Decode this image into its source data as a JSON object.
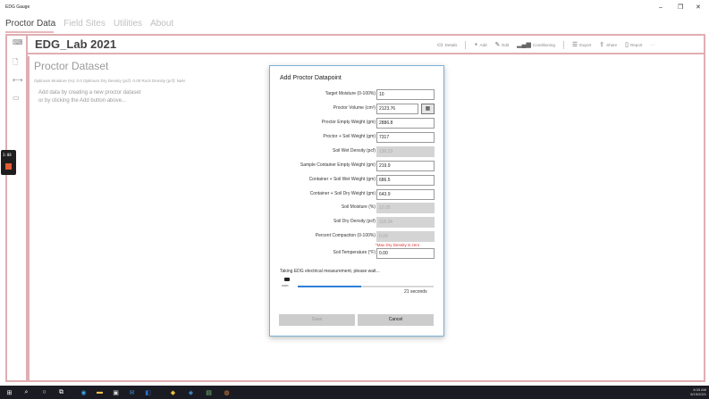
{
  "app": {
    "title": "EDG Gauge",
    "window_controls": {
      "minimize": "–",
      "maximize": "❐",
      "close": "✕"
    }
  },
  "nav": {
    "tabs": [
      {
        "label": "Proctor Data",
        "active": true
      },
      {
        "label": "Field Sites",
        "active": false
      },
      {
        "label": "Utilities",
        "active": false
      },
      {
        "label": "About",
        "active": false
      }
    ]
  },
  "header": {
    "title": "EDG_Lab  2021"
  },
  "toolbar": {
    "details": "Details",
    "add": "Add",
    "edit": "Edit",
    "conditioning": "Conditioning",
    "export": "Export",
    "share": "Share",
    "report": "Report",
    "more": "···"
  },
  "dataset": {
    "title": "Proctor Dataset",
    "meta": "Optimum Moisture (%): 0.0  Optimum Dry Density (pcf): 0.00  Rock Density (pcf): NaN",
    "hint_line1": "Add data by creating a new proctor dataset",
    "hint_line2": "or by clicking the Add button above..."
  },
  "recorder": {
    "time": "3:08"
  },
  "dialog": {
    "title": "Add Proctor Datapoint",
    "fields": [
      {
        "label": "Target Moisture (0-100%)",
        "value": "10",
        "readonly": false
      },
      {
        "label": "Proctor Volume (cm³)",
        "value": "2123.76",
        "readonly": false
      },
      {
        "label": "Proctor Empty Weight (gm)",
        "value": "2886.8",
        "readonly": false
      },
      {
        "label": "Proctor + Soil Weight (gm)",
        "value": "7317",
        "readonly": false
      },
      {
        "label": "Soil Wet Density (pcf)",
        "value": "130.23",
        "readonly": true
      },
      {
        "label": "Sample Container Empty Weight (gm)",
        "value": "219.9",
        "readonly": false
      },
      {
        "label": "Container + Soil Wet Weight (gm)",
        "value": "686.5",
        "readonly": false
      },
      {
        "label": "Container + Soil Dry Weight (gm)",
        "value": "643.9",
        "readonly": false
      },
      {
        "label": "Soil Moisture (%)",
        "value": "10.05",
        "readonly": true
      },
      {
        "label": "Soil Dry Density (pcf)",
        "value": "118.34",
        "readonly": true
      },
      {
        "label": "Percent Compaction (0-100%)",
        "value": "0.00",
        "readonly": true
      },
      {
        "label": "Soil Temperature (°F)",
        "value": "0.00",
        "readonly": false
      }
    ],
    "error": "*Max Dry Density is zero",
    "wait_text": "Taking EDG electrical measurement, please wait...",
    "battery_pct": "100%",
    "progress": 0.47,
    "seconds_text": "21 seconds",
    "save_label": "Save",
    "cancel_label": "Cancel"
  },
  "taskbar": {
    "time": "8:33 AM",
    "date": "5/19/2021"
  }
}
